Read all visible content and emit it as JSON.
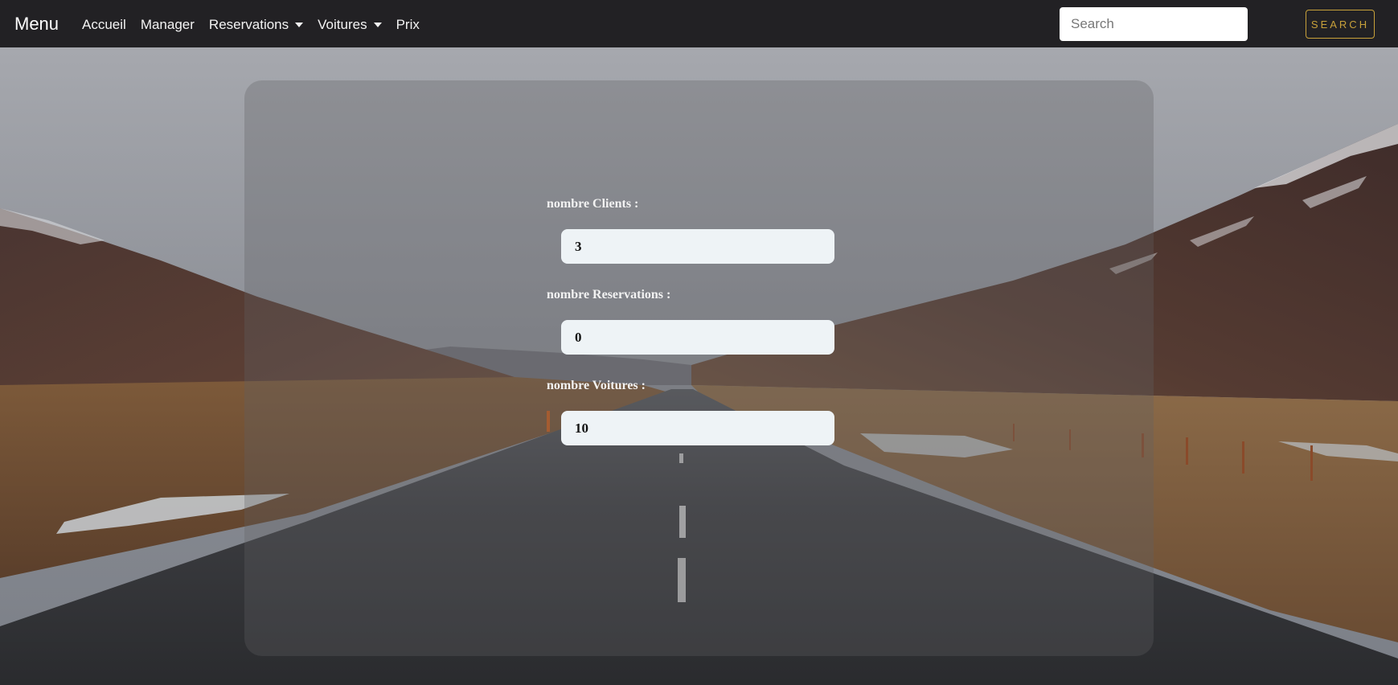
{
  "navbar": {
    "brand": "Menu",
    "links": [
      {
        "label": "Accueil"
      },
      {
        "label": "Manager"
      },
      {
        "label": "Reservations",
        "dropdown": true
      },
      {
        "label": "Voitures",
        "dropdown": true
      },
      {
        "label": "Prix"
      }
    ],
    "search": {
      "placeholder": "Search",
      "value": ""
    },
    "search_button": "SEARCH"
  },
  "stats": {
    "clients": {
      "label": "nombre Clients :",
      "value": "3"
    },
    "reservations": {
      "label": "nombre Reservations :",
      "value": "0"
    },
    "voitures": {
      "label": "nombre Voitures :",
      "value": "10"
    }
  },
  "colors": {
    "navbar_bg": "#222124",
    "accent": "#c8a13a",
    "input_bg": "#eef3f6"
  }
}
